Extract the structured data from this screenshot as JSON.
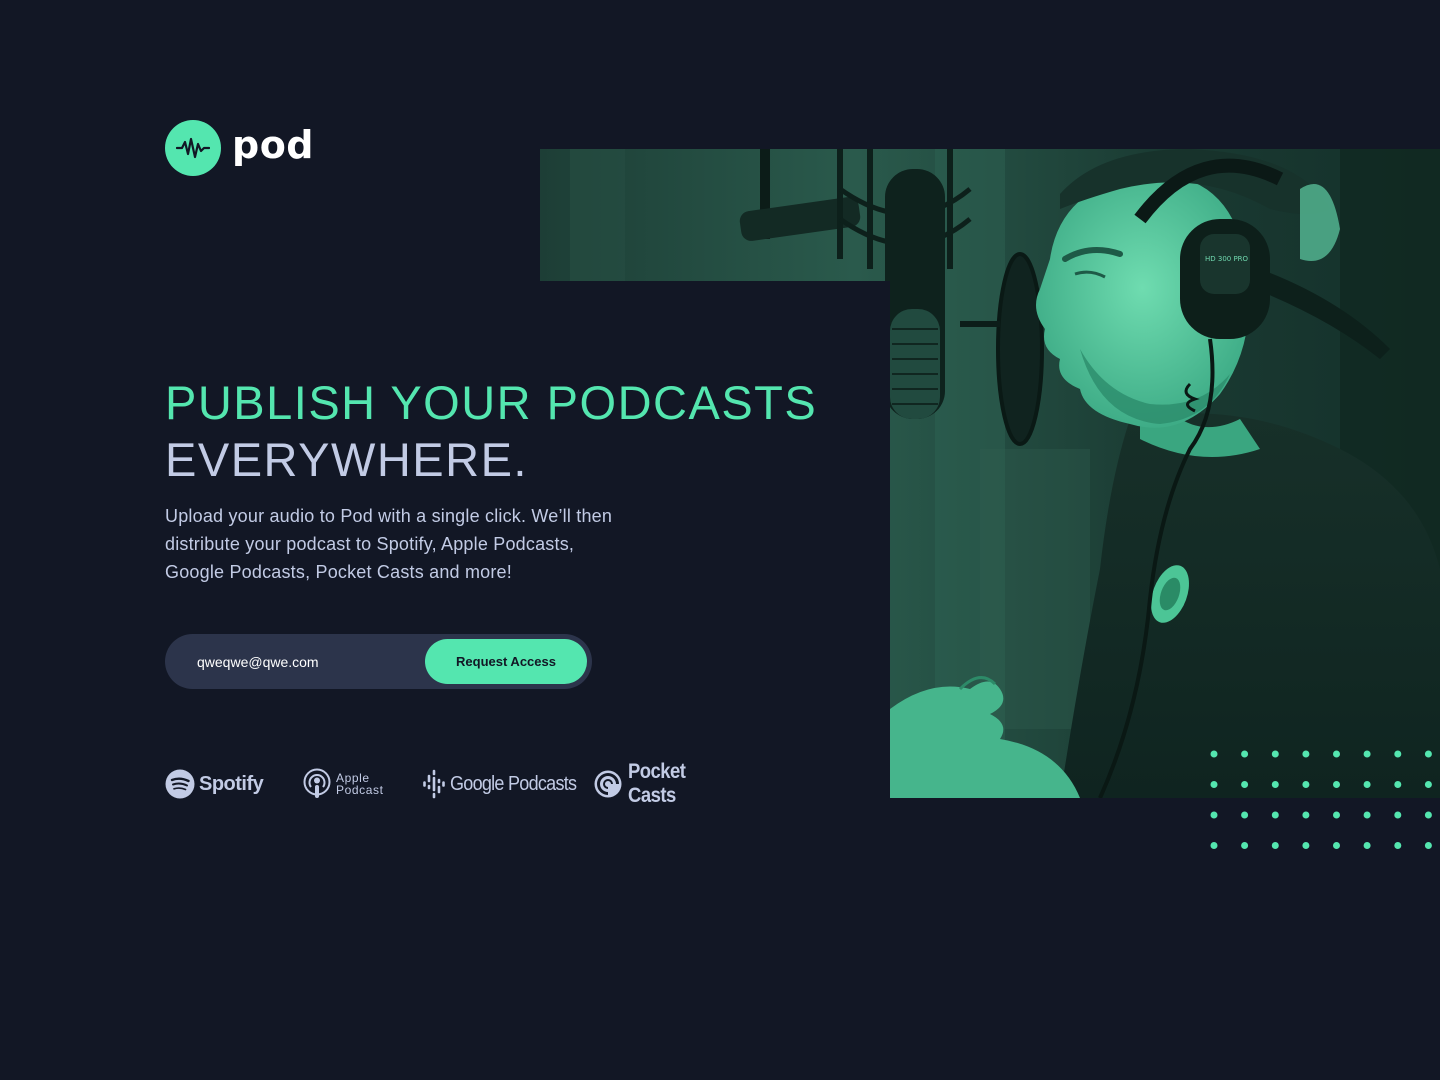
{
  "brand": {
    "name": "pod",
    "accent_color": "#54e6af",
    "background_color": "#121725",
    "text_color": "#c2cbe5"
  },
  "hero": {
    "headline_line1": "PUBLISH YOUR PODCASTS",
    "headline_line2": "EVERYWHERE.",
    "description": "Upload your audio to Pod with a single click. We’ll then distribute your podcast to Spotify, Apple Podcasts, Google Podcasts, Pocket Casts and more!"
  },
  "signup": {
    "email_value": "qweqwe@qwe.com",
    "submit_label": "Request Access"
  },
  "platforms": {
    "spotify": "Spotify",
    "apple_line1": "Apple",
    "apple_line2": "Podcast",
    "google": "Google Podcasts",
    "pocket_casts": "Pocket Casts"
  },
  "icons": {
    "logo": "waveform-logo-icon",
    "spotify": "spotify-icon",
    "apple": "apple-podcast-icon",
    "google": "google-podcasts-icon",
    "pocket_casts": "pocket-casts-icon"
  }
}
